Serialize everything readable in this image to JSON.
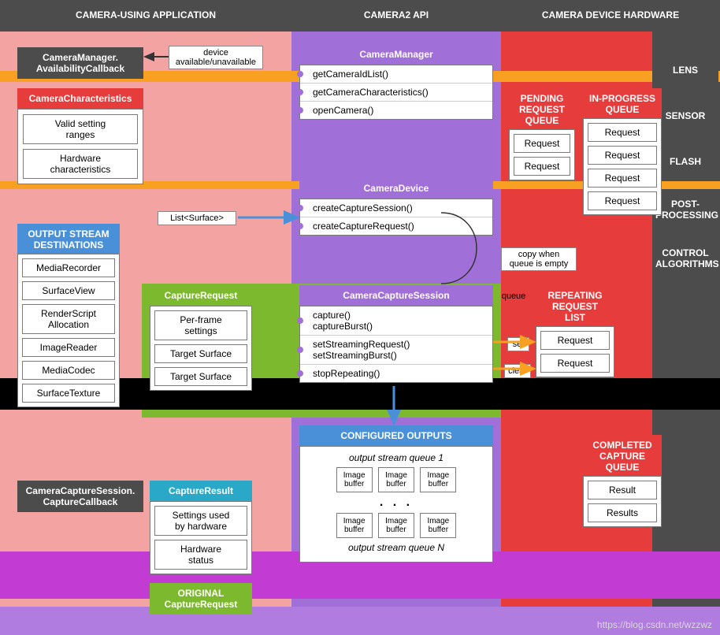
{
  "sections": {
    "app": "CAMERA-USING APPLICATION",
    "api": "CAMERA2 API",
    "hw": "CAMERA DEVICE HARDWARE"
  },
  "right_labels": {
    "lens": "LENS",
    "sensor": "SENSOR",
    "flash": "FLASH",
    "post": "POST-\nPROCESSING",
    "ctrl": "CONTROL\nALGORITHMS"
  },
  "left": {
    "avail_cb": "CameraManager.\nAvailabilityCallback",
    "cam_char_hdr": "CameraCharacteristics",
    "cam_char_items": [
      "Valid setting\nranges",
      "Hardware\ncharacteristics"
    ],
    "out_dest_hdr": "OUTPUT STREAM\nDESTINATIONS",
    "out_dest_items": [
      "MediaRecorder",
      "SurfaceView",
      "RenderScript\nAllocation",
      "ImageReader",
      "MediaCodec",
      "SurfaceTexture"
    ],
    "capture_cb": "CameraCaptureSession.\nCaptureCallback"
  },
  "mid_left": {
    "capreq_hdr": "CaptureRequest",
    "capreq_items": [
      "Per-frame\nsettings",
      "Target Surface",
      "Target Surface"
    ],
    "capres_hdr": "CaptureResult",
    "capres_items": [
      "Settings used\nby hardware",
      "Hardware\nstatus"
    ],
    "orig_req": "ORIGINAL\nCaptureRequest"
  },
  "api": {
    "camera_manager_hdr": "CameraManager",
    "camera_manager_methods": [
      "getCameraIdList()",
      "getCameraCharacteristics()",
      "openCamera()"
    ],
    "camera_device_hdr": "CameraDevice",
    "camera_device_methods": [
      "createCaptureSession()",
      "createCaptureRequest()"
    ],
    "session_hdr": "CameraCaptureSession",
    "session_methods": [
      "capture()\ncaptureBurst()",
      "setStreamingRequest()\nsetStreamingBurst()",
      "stopRepeating()"
    ],
    "configured_hdr": "CONFIGURED OUTPUTS",
    "stream_q1": "output stream queue 1",
    "stream_qN": "output stream queue N",
    "imgbuf": "Image\nbuffer",
    "dots": ". . ."
  },
  "annot": {
    "device_avail": "device\navailable/unavailable",
    "list_surface": "List<Surface>",
    "copy_empty": "copy when\nqueue is empty",
    "queue": "queue",
    "set": "set",
    "clear": "clear"
  },
  "hw": {
    "pending_hdr": "PENDING\nREQUEST\nQUEUE",
    "inprog_hdr": "IN-PROGRESS\nQUEUE",
    "repeating_hdr": "REPEATING\nREQUEST\nLIST",
    "completed_hdr": "COMPLETED\nCAPTURE\nQUEUE",
    "request": "Request",
    "result": "Result",
    "results": "Results"
  },
  "watermark": "https://blog.csdn.net/wzzwz"
}
